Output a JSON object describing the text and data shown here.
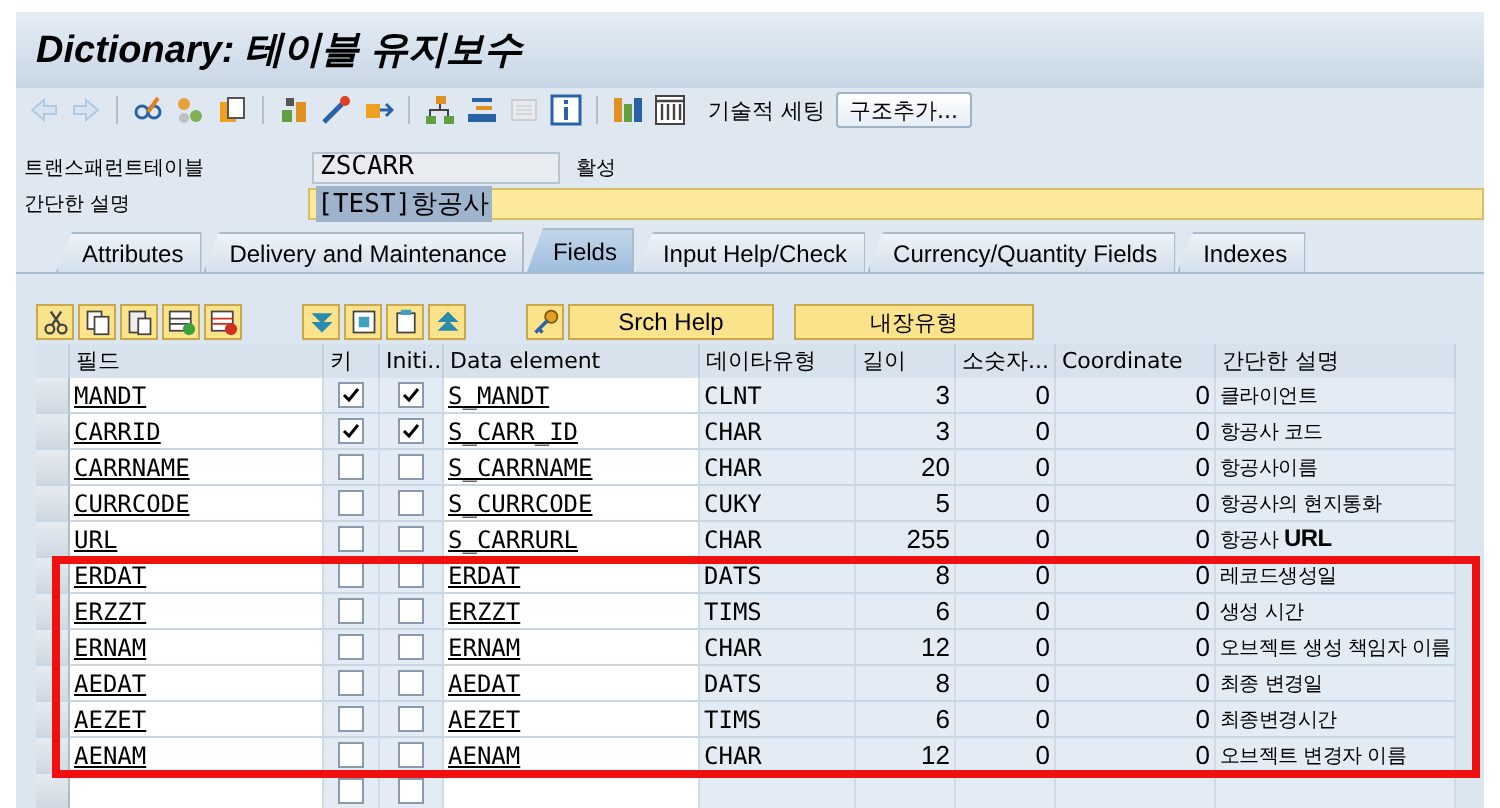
{
  "window": {
    "title": "Dictionary: 테이블 유지보수"
  },
  "toolbar": {
    "icons": [
      {
        "kind": "back",
        "disabled": true
      },
      {
        "kind": "forward",
        "disabled": true
      },
      {
        "kind": "glasses",
        "disabled": false
      },
      {
        "kind": "circles",
        "disabled": false
      },
      {
        "kind": "documents",
        "disabled": false
      },
      {
        "kind": "blocks",
        "disabled": false
      },
      {
        "kind": "wand",
        "disabled": false
      },
      {
        "kind": "plug",
        "disabled": false
      },
      {
        "kind": "hierarchy",
        "disabled": false
      },
      {
        "kind": "stack",
        "disabled": false
      },
      {
        "kind": "list",
        "disabled": true
      },
      {
        "kind": "info",
        "disabled": false
      },
      {
        "kind": "bars",
        "disabled": false
      },
      {
        "kind": "columns",
        "disabled": false
      }
    ],
    "text_button": "기술적 세팅",
    "button": "구조추가..."
  },
  "header": {
    "table_label": "트랜스패런트테이블",
    "table_value": "ZSCARR",
    "status": "활성",
    "description_label": "간단한 설명",
    "description_value": "[TEST]항공사"
  },
  "tabs": [
    {
      "label": "Attributes",
      "selected": false
    },
    {
      "label": "Delivery and Maintenance",
      "selected": false
    },
    {
      "label": "Fields",
      "selected": true
    },
    {
      "label": "Input Help/Check",
      "selected": false
    },
    {
      "label": "Currency/Quantity Fields",
      "selected": false
    },
    {
      "label": "Indexes",
      "selected": false
    }
  ],
  "table_toolbar": {
    "icons": [
      {
        "kind": "cut"
      },
      {
        "kind": "copy"
      },
      {
        "kind": "paste"
      },
      {
        "kind": "insert-row"
      },
      {
        "kind": "delete-row"
      },
      {
        "kind": "down"
      },
      {
        "kind": "frame-in"
      },
      {
        "kind": "frame-out"
      },
      {
        "kind": "up"
      },
      {
        "kind": "key"
      }
    ],
    "buttons": [
      "Srch Help",
      "내장유형"
    ]
  },
  "table": {
    "columns": [
      "필드",
      "키",
      "Initi...",
      "Data element",
      "데이타유형",
      "길이",
      "소숫자...",
      "Coordinate",
      "간단한 설명"
    ],
    "rows": [
      {
        "field": "MANDT",
        "key": true,
        "initial": true,
        "data_element": "S_MANDT",
        "data_type": "CLNT",
        "length": "3",
        "decimals": "0",
        "coordinate": "0",
        "description": "클라이언트",
        "highlighted": false
      },
      {
        "field": "CARRID",
        "key": true,
        "initial": true,
        "data_element": "S_CARR_ID",
        "data_type": "CHAR",
        "length": "3",
        "decimals": "0",
        "coordinate": "0",
        "description": "항공사 코드",
        "highlighted": false
      },
      {
        "field": "CARRNAME",
        "key": false,
        "initial": false,
        "data_element": "S_CARRNAME",
        "data_type": "CHAR",
        "length": "20",
        "decimals": "0",
        "coordinate": "0",
        "description": "항공사이름",
        "highlighted": false
      },
      {
        "field": "CURRCODE",
        "key": false,
        "initial": false,
        "data_element": "S_CURRCODE",
        "data_type": "CUKY",
        "length": "5",
        "decimals": "0",
        "coordinate": "0",
        "description": "항공사의 현지통화",
        "highlighted": false
      },
      {
        "field": "URL",
        "key": false,
        "initial": false,
        "data_element": "S_CARRURL",
        "data_type": "CHAR",
        "length": "255",
        "decimals": "0",
        "coordinate": "0",
        "description": "항공사 **URL**",
        "highlighted": false
      },
      {
        "field": "ERDAT",
        "key": false,
        "initial": false,
        "data_element": "ERDAT",
        "data_type": "DATS",
        "length": "8",
        "decimals": "0",
        "coordinate": "0",
        "description": "레코드생성일",
        "highlighted": true
      },
      {
        "field": "ERZZT",
        "key": false,
        "initial": false,
        "data_element": "ERZZT",
        "data_type": "TIMS",
        "length": "6",
        "decimals": "0",
        "coordinate": "0",
        "description": "생성 시간",
        "highlighted": true
      },
      {
        "field": "ERNAM",
        "key": false,
        "initial": false,
        "data_element": "ERNAM",
        "data_type": "CHAR",
        "length": "12",
        "decimals": "0",
        "coordinate": "0",
        "description": "오브젝트 생성 책임자 이름",
        "highlighted": true
      },
      {
        "field": "AEDAT",
        "key": false,
        "initial": false,
        "data_element": "AEDAT",
        "data_type": "DATS",
        "length": "8",
        "decimals": "0",
        "coordinate": "0",
        "description": "최종 변경일",
        "highlighted": true
      },
      {
        "field": "AEZET",
        "key": false,
        "initial": false,
        "data_element": "AEZET",
        "data_type": "TIMS",
        "length": "6",
        "decimals": "0",
        "coordinate": "0",
        "description": "최종변경시간",
        "highlighted": true
      },
      {
        "field": "AENAM",
        "key": false,
        "initial": false,
        "data_element": "AENAM",
        "data_type": "CHAR",
        "length": "12",
        "decimals": "0",
        "coordinate": "0",
        "description": "오브젝트 변경자 이름",
        "highlighted": true
      }
    ],
    "blank_row": {
      "key": false,
      "initial": false
    }
  }
}
